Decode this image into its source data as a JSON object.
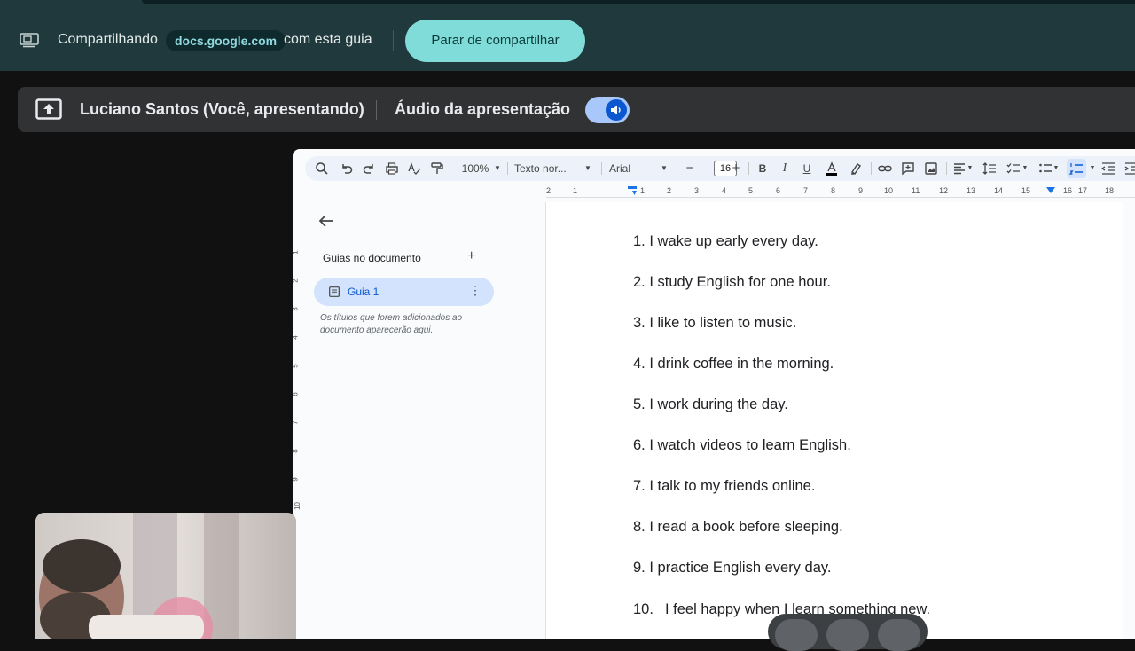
{
  "share_bar": {
    "sharing_label": "Compartilhando",
    "domain": "docs.google.com",
    "tab_suffix": "com esta guia",
    "stop_button": "Parar de compartilhar"
  },
  "presentation_bar": {
    "presenter": "Luciano Santos (Você, apresentando)",
    "audio_label": "Áudio da apresentação",
    "audio_enabled": true
  },
  "docs": {
    "toolbar": {
      "zoom": "100%",
      "style": "Texto nor...",
      "font": "Arial",
      "font_size": "16"
    },
    "ruler_numbers": [
      "2",
      "1",
      "1",
      "2",
      "3",
      "4",
      "5",
      "6",
      "7",
      "8",
      "9",
      "10",
      "11",
      "12",
      "13",
      "14",
      "15",
      "16",
      "17",
      "18"
    ],
    "vertical_ruler_numbers": [
      "1",
      "2",
      "3",
      "4",
      "5",
      "6",
      "7",
      "8",
      "9",
      "10"
    ],
    "outline": {
      "title": "Guias no documento",
      "tab_label": "Guia 1",
      "hint": "Os títulos que forem adicionados ao documento aparecerão aqui."
    },
    "document_lines": [
      {
        "number": "1.",
        "text": "I wake up early every day."
      },
      {
        "number": "2.",
        "text": "I study English for one hour."
      },
      {
        "number": "3.",
        "text": "I like to listen to music."
      },
      {
        "number": "4.",
        "text": "I drink coffee in the morning."
      },
      {
        "number": "5.",
        "text": "I work during the day."
      },
      {
        "number": "6.",
        "text": "I watch videos to learn English."
      },
      {
        "number": "7.",
        "text": "I talk to my friends online."
      },
      {
        "number": "8.",
        "text": "I read a book before sleeping."
      },
      {
        "number": "9.",
        "text": "I practice English every day."
      },
      {
        "number": "10.",
        "text": "I feel happy when I learn something new."
      }
    ]
  },
  "colors": {
    "share_bar_bg": "#20393c",
    "stop_button_bg": "#7fdcd8",
    "presentation_bar_bg": "#303234",
    "toggle_on": "#a8c7fa",
    "guia_active_bg": "#d3e3fd"
  }
}
